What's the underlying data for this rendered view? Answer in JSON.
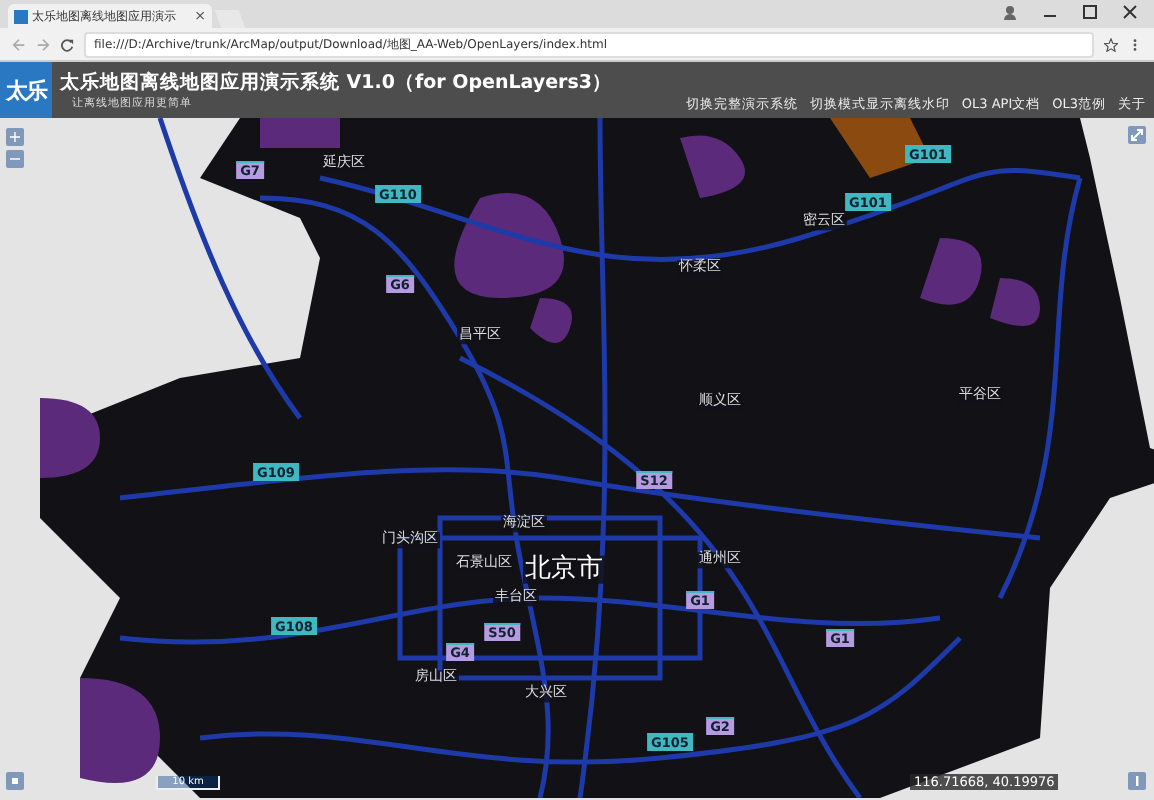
{
  "browser": {
    "tab_title": "太乐地图离线地图应用演示",
    "tab_close": "×",
    "url": "file:///D:/Archive/trunk/ArcMap/output/Download/地图_AA-Web/OpenLayers/index.html"
  },
  "header": {
    "logo": "太乐",
    "title": "太乐地图离线地图应用演示系统 V1.0（for OpenLayers3）",
    "subtitle": "让离线地图应用更简单",
    "menu": [
      "切换完整演示系统",
      "切换模式显示离线水印",
      "OL3 API文档",
      "OL3范例",
      "关于"
    ]
  },
  "map": {
    "zoom_in": "+",
    "zoom_out": "−",
    "place_labels": [
      {
        "text": "延庆区",
        "kind": "district"
      },
      {
        "text": "密云区",
        "kind": "district"
      },
      {
        "text": "怀柔区",
        "kind": "district"
      },
      {
        "text": "昌平区",
        "kind": "district"
      },
      {
        "text": "顺义区",
        "kind": "district"
      },
      {
        "text": "平谷区",
        "kind": "district"
      },
      {
        "text": "门头沟区",
        "kind": "district"
      },
      {
        "text": "海淀区",
        "kind": "district"
      },
      {
        "text": "石景山区",
        "kind": "district"
      },
      {
        "text": "北京市",
        "kind": "city"
      },
      {
        "text": "通州区",
        "kind": "district"
      },
      {
        "text": "丰台区",
        "kind": "district"
      },
      {
        "text": "房山区",
        "kind": "district"
      },
      {
        "text": "大兴区",
        "kind": "district"
      }
    ],
    "road_shields": [
      {
        "text": "G7",
        "color": "#b79be0"
      },
      {
        "text": "G110",
        "color": "#3fb8c0"
      },
      {
        "text": "G6",
        "color": "#b79be0"
      },
      {
        "text": "G101",
        "color": "#3fb8c0"
      },
      {
        "text": "G101",
        "color": "#3fb8c0"
      },
      {
        "text": "G109",
        "color": "#3fb8c0"
      },
      {
        "text": "S12",
        "color": "#b79be0"
      },
      {
        "text": "G108",
        "color": "#3fb8c0"
      },
      {
        "text": "S50",
        "color": "#b79be0"
      },
      {
        "text": "G4",
        "color": "#b79be0"
      },
      {
        "text": "G1",
        "color": "#b79be0"
      },
      {
        "text": "G1",
        "color": "#b79be0"
      },
      {
        "text": "G105",
        "color": "#3fb8c0"
      },
      {
        "text": "G2",
        "color": "#b79be0"
      }
    ],
    "scale": "10 km",
    "coordinates": "116.71668, 40.19976"
  }
}
